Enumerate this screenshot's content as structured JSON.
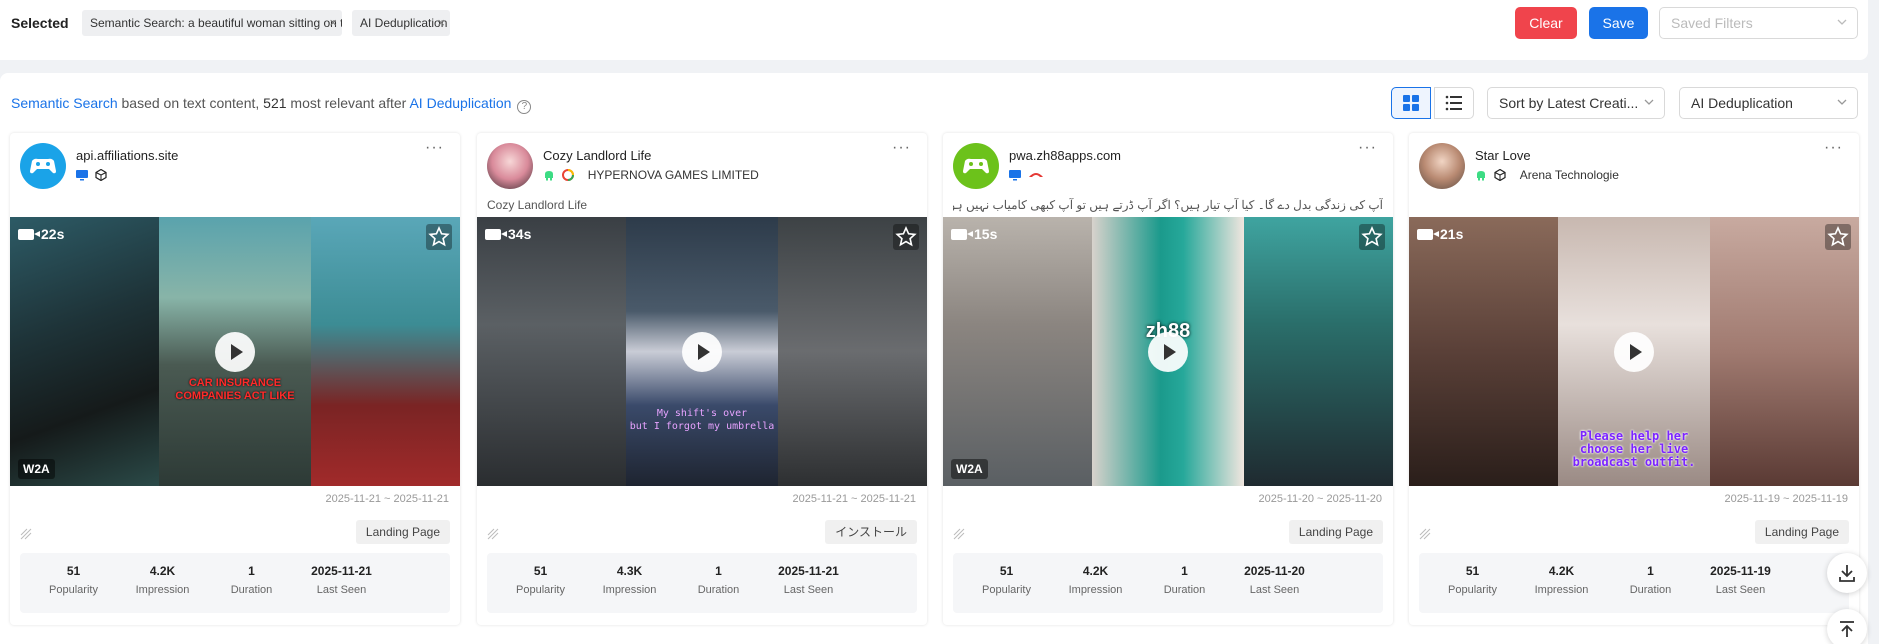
{
  "filters": {
    "selected_label": "Selected",
    "chips": [
      {
        "label": "Semantic Search: a beautiful woman sitting on the car"
      },
      {
        "label": "AI Deduplication"
      }
    ],
    "clear_label": "Clear",
    "save_label": "Save",
    "saved_filters_placeholder": "Saved Filters"
  },
  "summary": {
    "search_link": "Semantic Search",
    "text_1": " based on text content, ",
    "count": "521",
    "text_2": " most relevant after ",
    "dedup_link": "AI Deduplication",
    "help": "?"
  },
  "toolbar": {
    "sort_value": "Sort by Latest Creati...",
    "dedup_value": "AI Deduplication"
  },
  "cards": [
    {
      "advertiser": "api.affiliations.site",
      "platforms": [
        "desktop-icon",
        "unity-icon"
      ],
      "company": "",
      "ad_text": "",
      "duration_badge": "22s",
      "tag": "W2A",
      "overlay": "CAR INSURANCE\nCOMPANIES ACT LIKE",
      "date_range": "2025-11-21 ~ 2025-11-21",
      "cta": "Landing Page",
      "stats": {
        "popularity": "51",
        "impression": "4.2K",
        "duration": "1",
        "last_seen": "2025-11-21"
      }
    },
    {
      "advertiser": "Cozy Landlord Life",
      "platforms": [
        "android-icon",
        "google-ads-icon"
      ],
      "company": "HYPERNOVA GAMES LIMITED",
      "ad_text": "Cozy Landlord Life",
      "duration_badge": "34s",
      "tag": "",
      "overlay": "My shift's over\nbut I forgot my umbrella",
      "date_range": "2025-11-21 ~ 2025-11-21",
      "cta": "インストール",
      "stats": {
        "popularity": "51",
        "impression": "4.3K",
        "duration": "1",
        "last_seen": "2025-11-21"
      }
    },
    {
      "advertiser": "pwa.zh88apps.com",
      "platforms": [
        "desktop-icon",
        "network-icon"
      ],
      "company": "",
      "ad_text": "آپ کی زندگی بدل دے گا۔ کیا آپ تیار ہیں؟ اگر آپ ڈرتے ہیں تو آپ کبھی کامیاب نہیں ہوں گے۔",
      "duration_badge": "15s",
      "tag": "W2A",
      "overlay": "zh88",
      "date_range": "2025-11-20 ~ 2025-11-20",
      "cta": "Landing Page",
      "stats": {
        "popularity": "51",
        "impression": "4.2K",
        "duration": "1",
        "last_seen": "2025-11-20"
      }
    },
    {
      "advertiser": "Star Love",
      "platforms": [
        "android-icon",
        "unity-icon"
      ],
      "company": "Arena Technologie",
      "ad_text": "",
      "duration_badge": "21s",
      "tag": "",
      "overlay": "Please help her\nchoose her live\nbroadcast outfit.",
      "date_range": "2025-11-19 ~ 2025-11-19",
      "cta": "Landing Page",
      "stats": {
        "popularity": "51",
        "impression": "4.2K",
        "duration": "1",
        "last_seen": "2025-11-19"
      }
    }
  ],
  "stat_labels": {
    "popularity": "Popularity",
    "impression": "Impression",
    "duration": "Duration",
    "last_seen": "Last Seen"
  },
  "icons": {
    "more": "more-icon",
    "star": "star-icon",
    "play": "play-icon",
    "video": "video-icon",
    "download": "download-icon",
    "back_to_top": "back-to-top-icon"
  },
  "colors": {
    "accent": "#1a73e8",
    "clear": "#f0444c"
  }
}
